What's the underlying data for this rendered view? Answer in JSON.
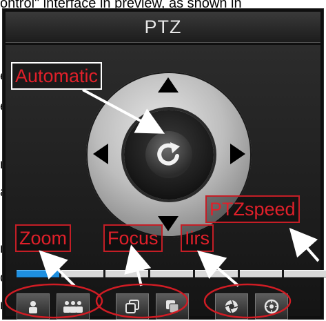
{
  "document": {
    "top_line": "ontrol\" interface in preview, as shown in",
    "left_fragments": [
      "e",
      "e",
      "n",
      "a",
      "n",
      "d",
      "r"
    ]
  },
  "panel": {
    "title": "PTZ",
    "center_button_icon": "refresh-icon",
    "arrows": [
      "up-arrow-icon",
      "down-arrow-icon",
      "left-arrow-icon",
      "right-arrow-icon"
    ]
  },
  "speed": {
    "segments": 7,
    "active_segments": 1,
    "fill_fraction": 0.14
  },
  "controls": {
    "zoom": [
      "zoom-in-icon",
      "zoom-out-icon"
    ],
    "focus": [
      "focus-near-icon",
      "focus-far-icon"
    ],
    "iris": [
      "iris-open-icon",
      "iris-close-icon"
    ]
  },
  "annotations": {
    "automatic": "Automatic",
    "ptz_speed": "PTZspeed",
    "zoom": "Zoom",
    "focus": "Focus",
    "iris": "Iirs"
  },
  "colors": {
    "annotation_text": "#e0202a",
    "speed_active": "#1e8fe0",
    "arrow": "#ffffff"
  }
}
